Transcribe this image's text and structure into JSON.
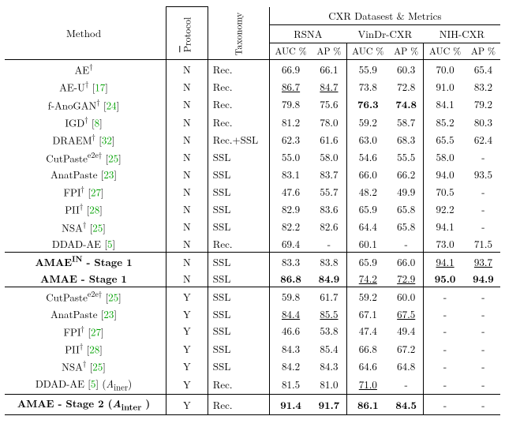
{
  "header": {
    "method": "Method",
    "protocol": "Protocol",
    "protocol_overline": "P",
    "taxonomy": "Taxonomy",
    "group": "CXR Datasest & Metrics",
    "ds1": "RSNA",
    "ds2": "VinDr-CXR",
    "ds3": "NIH-CXR",
    "auc": "AUC %",
    "ap": "AP %"
  },
  "rows_a": [
    {
      "method": "AE",
      "dag": "†",
      "cite": "",
      "proto": "N",
      "tax": "Rec.",
      "r1": "66.9",
      "r2": "66.1",
      "r3": "55.9",
      "r4": "60.3",
      "r5": "70.0",
      "r6": "65.4"
    },
    {
      "method": "AE-U",
      "dag": "†",
      "cite": "17",
      "proto": "N",
      "tax": "Rec.",
      "r1": "86.7",
      "r2": "84.7",
      "r3": "73.8",
      "r4": "72.8",
      "r5": "91.0",
      "r6": "83.2",
      "u": {
        "r1": 1,
        "r2": 1
      }
    },
    {
      "method": "f-AnoGAN",
      "dag": "†",
      "cite": "24",
      "proto": "N",
      "tax": "Rec.",
      "r1": "79.8",
      "r2": "75.6",
      "r3": "76.3",
      "r4": "74.8",
      "r5": "84.1",
      "r6": "79.2",
      "b": {
        "r3": 1,
        "r4": 1
      }
    },
    {
      "method": "IGD",
      "dag": "†",
      "cite": "8",
      "proto": "N",
      "tax": "Rec.",
      "r1": "81.2",
      "r2": "78.0",
      "r3": "59.2",
      "r4": "58.7",
      "r5": "85.2",
      "r6": "80.3"
    },
    {
      "method": "DRAEM",
      "dag": "†",
      "cite": "32",
      "proto": "N",
      "tax": "Rec.+SSL",
      "r1": "62.3",
      "r2": "61.6",
      "r3": "63.0",
      "r4": "68.3",
      "r5": "65.5",
      "r6": "62.4"
    },
    {
      "method": "CutPaste",
      "sup": "e2e†",
      "cite": "25",
      "proto": "N",
      "tax": "SSL",
      "r1": "55.0",
      "r2": "58.0",
      "r3": "54.6",
      "r4": "55.5",
      "r5": "58.0",
      "r6": "-"
    },
    {
      "method": "AnatPaste",
      "cite": "23",
      "proto": "N",
      "tax": "SSL",
      "r1": "83.1",
      "r2": "83.7",
      "r3": "66.0",
      "r4": "66.2",
      "r5": "94.0",
      "r6": "93.5"
    },
    {
      "method": "FPI",
      "dag": "†",
      "cite": "27",
      "proto": "N",
      "tax": "SSL",
      "r1": "47.6",
      "r2": "55.7",
      "r3": "48.2",
      "r4": "49.9",
      "r5": "70.5",
      "r6": "-"
    },
    {
      "method": "PII",
      "dag": "†",
      "cite": "28",
      "proto": "N",
      "tax": "SSL",
      "r1": "82.9",
      "r2": "83.6",
      "r3": "65.9",
      "r4": "65.8",
      "r5": "92.2",
      "r6": "-"
    },
    {
      "method": "NSA",
      "dag": "†",
      "cite": "25",
      "proto": "N",
      "tax": "SSL",
      "r1": "82.2",
      "r2": "82.6",
      "r3": "64.4",
      "r4": "65.8",
      "r5": "94.1",
      "r6": "-"
    },
    {
      "method": "DDAD-AE",
      "cite": "5",
      "proto": "N",
      "tax": "Rec.",
      "r1": "69.4",
      "r2": "-",
      "r3": "60.1",
      "r4": "-",
      "r5": "73.0",
      "r6": "71.5"
    }
  ],
  "rows_b": [
    {
      "method_html": "AMAE<sup>IN</sup> - Stage 1",
      "bold": true,
      "proto": "N",
      "tax": "SSL",
      "r1": "83.3",
      "r2": "83.8",
      "r3": "65.9",
      "r4": "66.0",
      "r5": "94.1",
      "r6": "93.7",
      "u": {
        "r5": 1,
        "r6": 1
      }
    },
    {
      "method_html": "AMAE - Stage 1",
      "bold": true,
      "proto": "N",
      "tax": "SSL",
      "r1": "86.8",
      "r2": "84.9",
      "r3": "74.2",
      "r4": "72.9",
      "r5": "95.0",
      "r6": "94.9",
      "b": {
        "r1": 1,
        "r2": 1,
        "r5": 1,
        "r6": 1
      },
      "u": {
        "r3": 1,
        "r4": 1
      }
    }
  ],
  "rows_c": [
    {
      "method": "CutPaste",
      "sup": "e2e†",
      "cite": "25",
      "proto": "Y",
      "tax": "SSL",
      "r1": "59.8",
      "r2": "61.7",
      "r3": "59.2",
      "r4": "60.0",
      "r5": "-",
      "r6": "-"
    },
    {
      "method": "AnatPaste",
      "cite": "23",
      "proto": "Y",
      "tax": "SSL",
      "r1": "84.4",
      "r2": "85.5",
      "r3": "67.1",
      "r4": "67.5",
      "r5": "-",
      "r6": "-",
      "u": {
        "r1": 1,
        "r2": 1,
        "r4": 1
      }
    },
    {
      "method": "FPI",
      "dag": "†",
      "cite": "27",
      "proto": "Y",
      "tax": "SSL",
      "r1": "46.6",
      "r2": "53.8",
      "r3": "47.4",
      "r4": "49.4",
      "r5": "-",
      "r6": "-"
    },
    {
      "method": "PII",
      "dag": "†",
      "cite": "28",
      "proto": "Y",
      "tax": "SSL",
      "r1": "84.3",
      "r2": "85.4",
      "r3": "66.8",
      "r4": "67.2",
      "r5": "-",
      "r6": "-"
    },
    {
      "method": "NSA",
      "dag": "†",
      "cite": "25",
      "proto": "Y",
      "tax": "SSL",
      "r1": "84.2",
      "r2": "84.3",
      "r3": "64.6",
      "r4": "64.8",
      "r5": "-",
      "r6": "-"
    },
    {
      "method_html": "DDAD-AE [<a class='cite' href='#'>5</a>] (<i>A</i><sub>iner</sub>)",
      "proto": "Y",
      "tax": "Rec.",
      "r1": "81.5",
      "r2": "81.0",
      "r3": "71.0",
      "r4": "-",
      "r5": "-",
      "r6": "-",
      "u": {
        "r3": 1
      }
    }
  ],
  "rows_d": [
    {
      "method_html": "AMAE - Stage 2 (<i>A</i><sub>inter</sub> )",
      "bold": true,
      "proto": "Y",
      "tax": "Rec.",
      "r1": "91.4",
      "r2": "91.7",
      "r3": "86.1",
      "r4": "84.5",
      "r5": "-",
      "r6": "-",
      "b": {
        "r1": 1,
        "r2": 1,
        "r3": 1,
        "r4": 1
      }
    }
  ]
}
